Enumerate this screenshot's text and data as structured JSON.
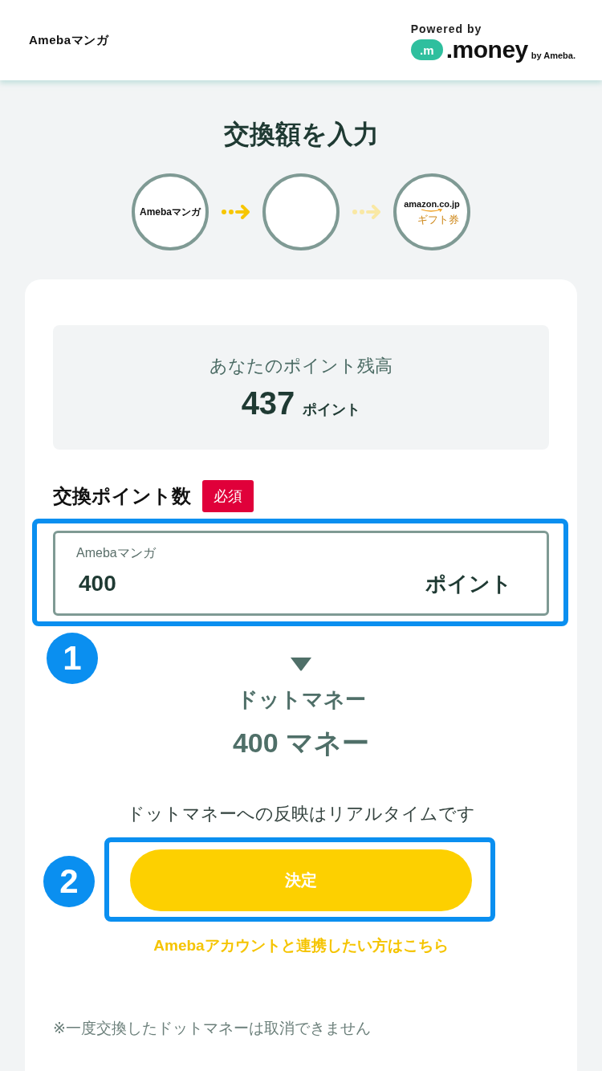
{
  "header": {
    "logo": "Amebaマンガ",
    "powered_by": "Powered by",
    "partner_badge": ".m",
    "partner_name": ".money",
    "partner_suffix": "by Ameba."
  },
  "title": "交換額を入力",
  "steps": [
    {
      "kind": "brand",
      "text": "Amebaマンガ"
    },
    {
      "kind": "blank"
    },
    {
      "kind": "gift",
      "text": "amazon.co.jp",
      "subtext": "ギフト券"
    }
  ],
  "arrows": [
    {
      "active": true
    },
    {
      "active": false
    }
  ],
  "balance": {
    "label": "あなたのポイント残高",
    "value": "437",
    "unit": "ポイント"
  },
  "exchange": {
    "label": "交換ポイント数",
    "required_badge": "必須",
    "field": {
      "label": "Amebaマンガ",
      "value": "400",
      "unit": "ポイント",
      "annotation": "1"
    }
  },
  "conversion": {
    "label": "ドットマネー",
    "amount": "400 マネー"
  },
  "notice": "ドットマネーへの反映はリアルタイムです",
  "submit": {
    "label": "決定",
    "annotation": "2"
  },
  "link": "Amebaアカウントと連携したい方はこちら",
  "footnote": "※一度交換したドットマネーは取消できません"
}
